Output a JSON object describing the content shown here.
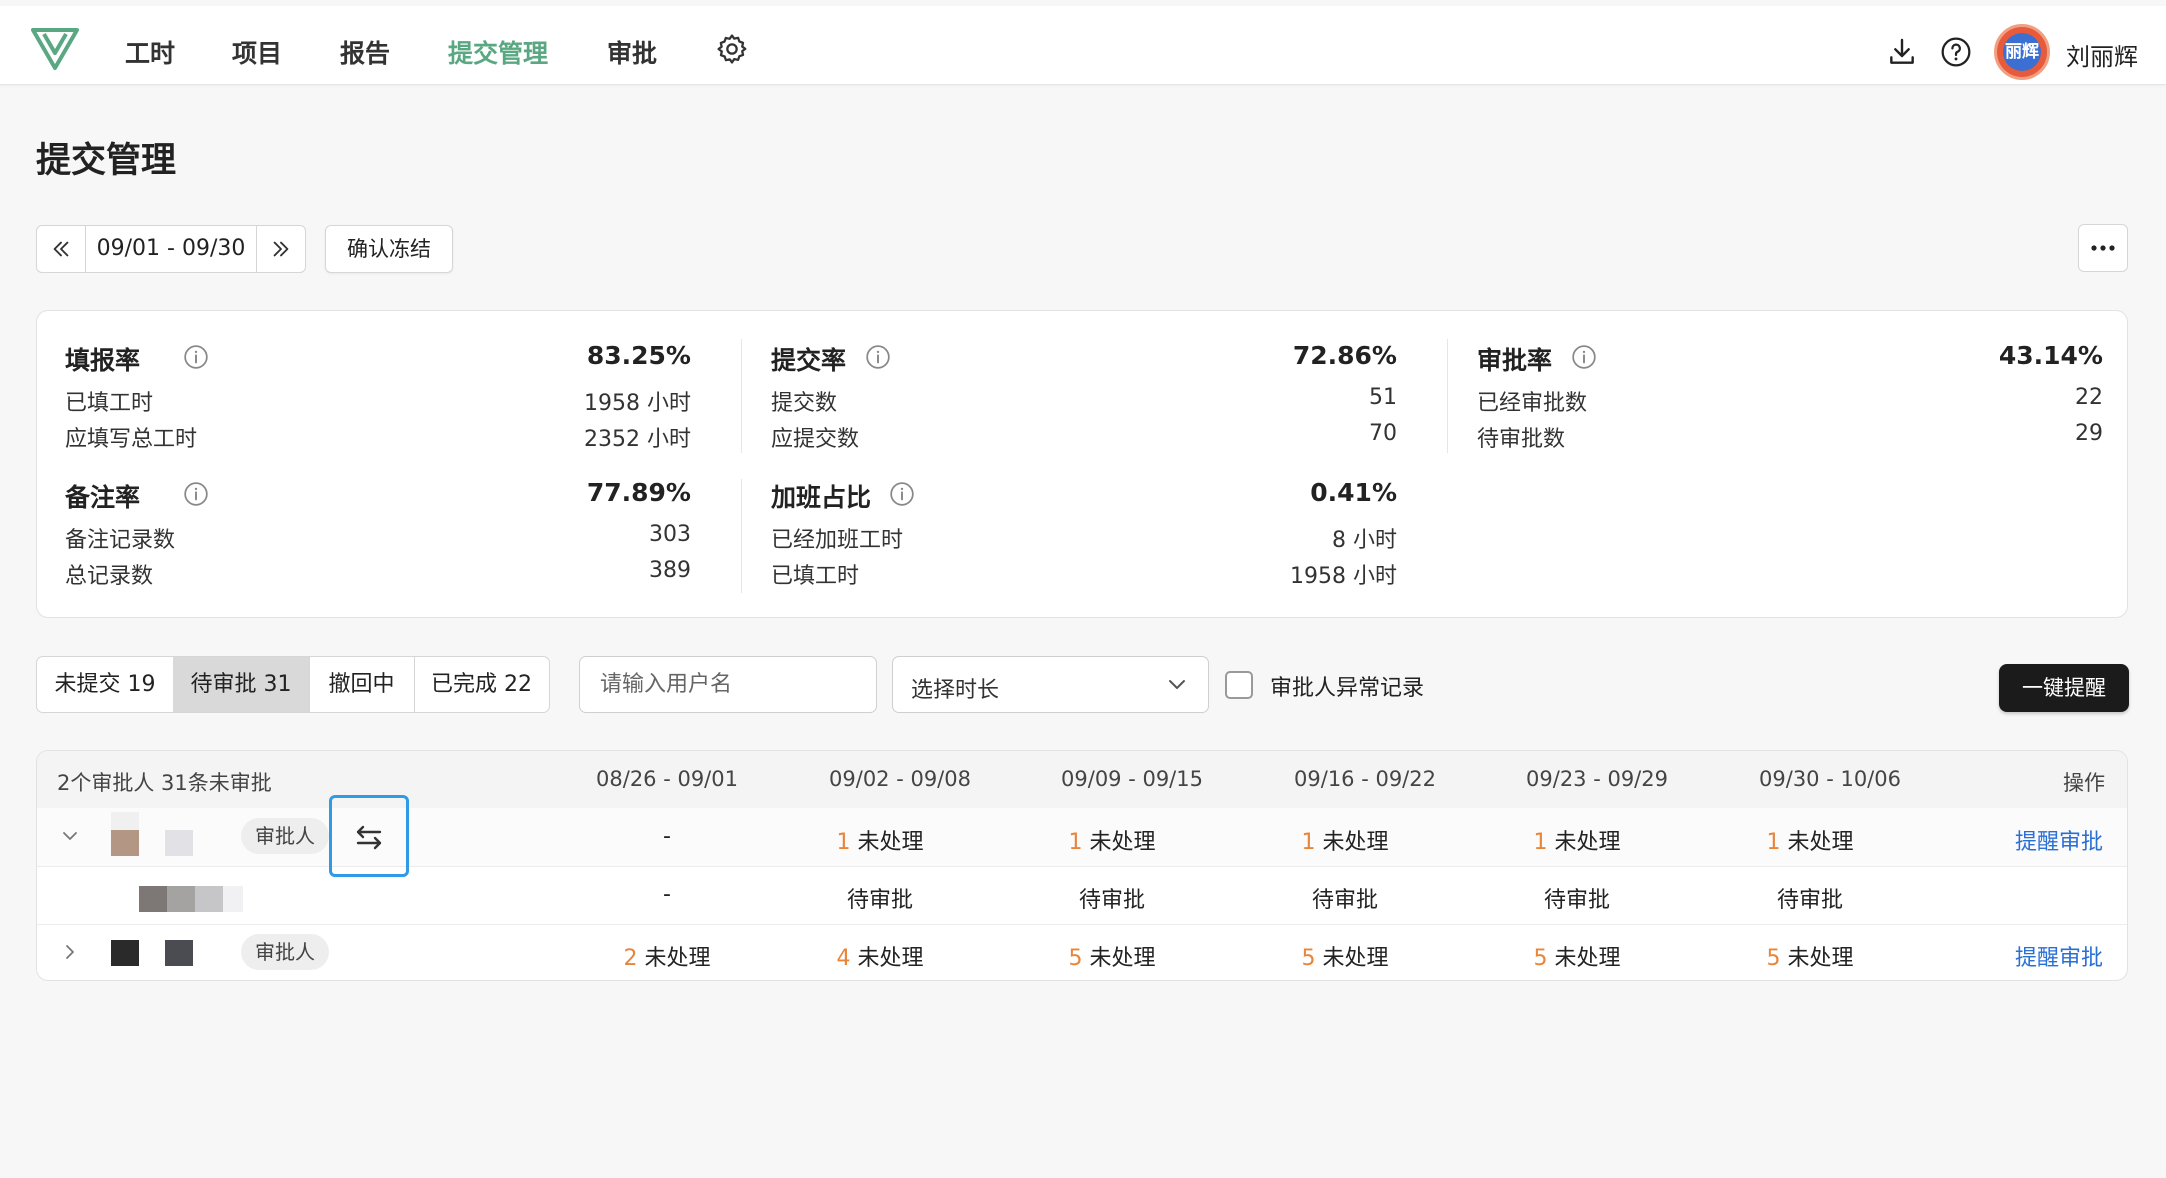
{
  "nav": {
    "items": [
      {
        "label": "工时"
      },
      {
        "label": "项目"
      },
      {
        "label": "报告"
      },
      {
        "label": "提交管理"
      },
      {
        "label": "审批"
      }
    ],
    "active": "提交管理",
    "accent": "#5aa882",
    "avatar_text": "丽辉",
    "user_name": "刘丽辉"
  },
  "page": {
    "title": "提交管理",
    "date_range": "09/01 - 09/30",
    "freeze_label": "确认冻结"
  },
  "stats": {
    "fill": {
      "title": "填报率",
      "pct": "83.25%",
      "rows": [
        {
          "label": "已填工时",
          "value": "1958 小时"
        },
        {
          "label": "应填写总工时",
          "value": "2352 小时"
        }
      ]
    },
    "submit": {
      "title": "提交率",
      "pct": "72.86%",
      "rows": [
        {
          "label": "提交数",
          "value": "51"
        },
        {
          "label": "应提交数",
          "value": "70"
        }
      ]
    },
    "approve": {
      "title": "审批率",
      "pct": "43.14%",
      "rows": [
        {
          "label": "已经审批数",
          "value": "22"
        },
        {
          "label": "待审批数",
          "value": "29"
        }
      ]
    },
    "note": {
      "title": "备注率",
      "pct": "77.89%",
      "rows": [
        {
          "label": "备注记录数",
          "value": "303"
        },
        {
          "label": "总记录数",
          "value": "389"
        }
      ]
    },
    "overtime": {
      "title": "加班占比",
      "pct": "0.41%",
      "rows": [
        {
          "label": "已经加班工时",
          "value": "8 小时"
        },
        {
          "label": "已填工时",
          "value": "1958 小时"
        }
      ]
    }
  },
  "filters": {
    "tabs": [
      {
        "label": "未提交 19"
      },
      {
        "label": "待审批 31"
      },
      {
        "label": "撤回中"
      },
      {
        "label": "已完成 22"
      }
    ],
    "active_tab": "待审批 31",
    "search_placeholder": "请输入用户名",
    "duration_placeholder": "选择时长",
    "abnormal_label": "审批人异常记录",
    "remind_all_label": "一键提醒"
  },
  "table": {
    "summary": "2个审批人 31条未审批",
    "weeks": [
      "08/26 - 09/01",
      "09/02 - 09/08",
      "09/09 - 09/15",
      "09/16 - 09/22",
      "09/23 - 09/29",
      "09/30 - 10/06"
    ],
    "action_header": "操作",
    "tag_label": "审批人",
    "remind_label": "提醒审批",
    "row1": {
      "cells": [
        {
          "text": "-"
        },
        {
          "n": "1",
          "t": "未处理"
        },
        {
          "n": "1",
          "t": "未处理"
        },
        {
          "n": "1",
          "t": "未处理"
        },
        {
          "n": "1",
          "t": "未处理"
        },
        {
          "n": "1",
          "t": "未处理"
        }
      ]
    },
    "row2": {
      "cells": [
        "-",
        "待审批",
        "待审批",
        "待审批",
        "待审批",
        "待审批"
      ]
    },
    "row3": {
      "cells": [
        {
          "n": "2",
          "t": "未处理"
        },
        {
          "n": "4",
          "t": "未处理"
        },
        {
          "n": "5",
          "t": "未处理"
        },
        {
          "n": "5",
          "t": "未处理"
        },
        {
          "n": "5",
          "t": "未处理"
        },
        {
          "n": "5",
          "t": "未处理"
        }
      ]
    },
    "number_color": "#e8853a",
    "link_color": "#2a6fd6"
  }
}
